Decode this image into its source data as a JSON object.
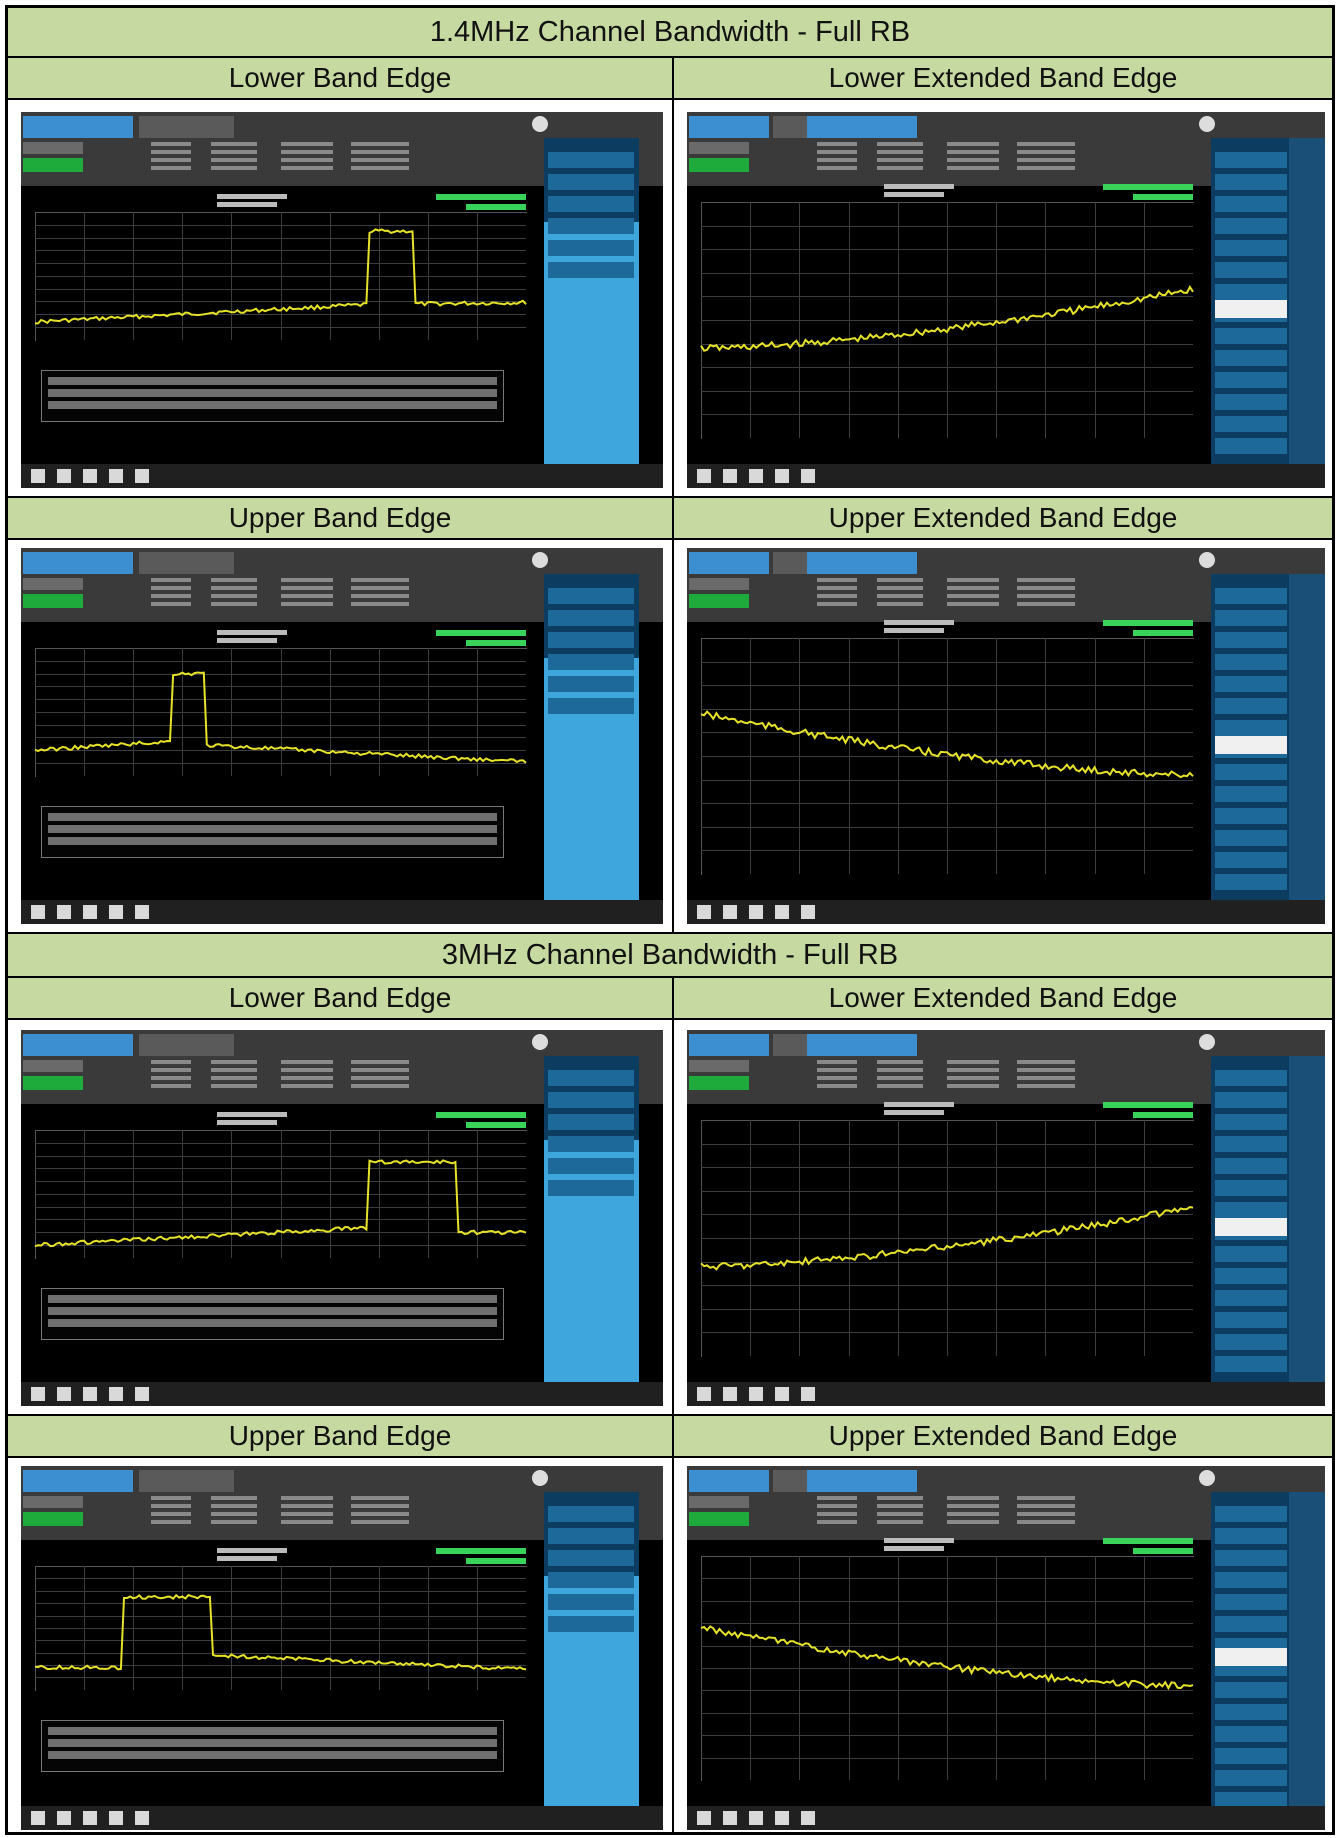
{
  "sections": [
    {
      "title": "1.4MHz Channel Bandwidth - Full RB"
    },
    {
      "title": "3MHz Channel Bandwidth - Full RB"
    }
  ],
  "cells": {
    "s1_r1_left": "Lower Band Edge",
    "s1_r1_right": "Lower Extended Band Edge",
    "s1_r2_left": "Upper Band Edge",
    "s1_r2_right": "Upper Extended Band Edge",
    "s2_r1_left": "Lower Band Edge",
    "s2_r1_right": "Lower Extended Band Edge",
    "s2_r2_left": "Upper Band Edge",
    "s2_r2_right": "Upper Extended Band Edge"
  },
  "screenshots": [
    {
      "name": "s1-lower-band-edge",
      "kind": "band-edge-lower"
    },
    {
      "name": "s1-lower-extended",
      "kind": "extended-rising"
    },
    {
      "name": "s1-upper-band-edge",
      "kind": "band-edge-upper"
    },
    {
      "name": "s1-upper-extended",
      "kind": "extended-falling"
    },
    {
      "name": "s2-lower-band-edge",
      "kind": "band-edge-lower-wide"
    },
    {
      "name": "s2-lower-extended",
      "kind": "extended-rising"
    },
    {
      "name": "s2-upper-band-edge",
      "kind": "band-edge-upper-wide"
    },
    {
      "name": "s2-upper-extended",
      "kind": "extended-falling"
    }
  ],
  "colors": {
    "header_bg": "#c6d9a1",
    "trace": "#e6e22a",
    "analyzer_bg": "#000000",
    "panel_blue": "#3fa6dd",
    "panel_dark": "#0c3d60"
  }
}
